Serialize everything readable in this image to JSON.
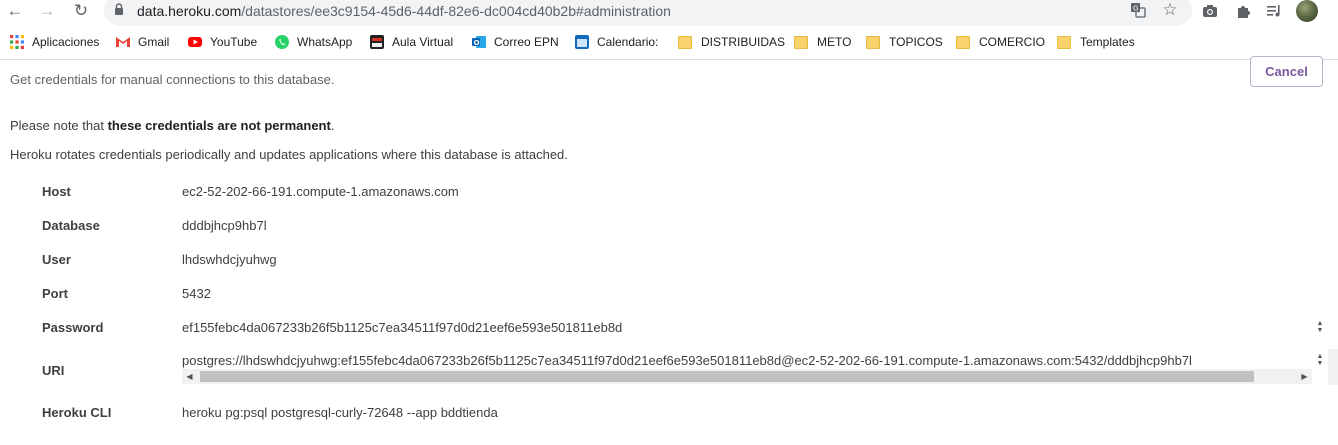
{
  "browser": {
    "url_host": "data.heroku.com",
    "url_path": "/datastores/ee3c9154-45d6-44df-82e6-dc004cd40b2b#administration"
  },
  "bookmarks": [
    {
      "label": "Aplicaciones",
      "icon": "apps-grid-icon"
    },
    {
      "label": "Gmail",
      "icon": "gmail-icon"
    },
    {
      "label": "YouTube",
      "icon": "youtube-icon"
    },
    {
      "label": "WhatsApp",
      "icon": "whatsapp-icon"
    },
    {
      "label": "Aula Virtual",
      "icon": "aula-virtual-icon"
    },
    {
      "label": "Correo EPN",
      "icon": "outlook-icon"
    },
    {
      "label": "Calendario:",
      "icon": "calendar-icon"
    },
    {
      "label": "DISTRIBUIDAS",
      "icon": "folder-icon"
    },
    {
      "label": "METO",
      "icon": "folder-icon"
    },
    {
      "label": "TOPICOS",
      "icon": "folder-icon"
    },
    {
      "label": "COMERCIO",
      "icon": "folder-icon"
    },
    {
      "label": "Templates",
      "icon": "folder-icon"
    }
  ],
  "page": {
    "subtitle": "Get credentials for manual connections to this database.",
    "cancel_label": "Cancel",
    "note_prefix": "Please note that ",
    "note_bold": "these credentials are not permanent",
    "note_suffix": ".",
    "rotation_note": "Heroku rotates credentials periodically and updates applications where this database is attached."
  },
  "credentials": {
    "host": {
      "label": "Host",
      "value": "ec2-52-202-66-191.compute-1.amazonaws.com"
    },
    "database": {
      "label": "Database",
      "value": "dddbjhcp9hb7l"
    },
    "user": {
      "label": "User",
      "value": "lhdswhdcjyuhwg"
    },
    "port": {
      "label": "Port",
      "value": "5432"
    },
    "password": {
      "label": "Password",
      "value": "ef155febc4da067233b26f5b1125c7ea34511f97d0d21eef6e593e501811eb8d"
    },
    "uri": {
      "label": "URI",
      "value": "postgres://lhdswhdcjyuhwg:ef155febc4da067233b26f5b1125c7ea34511f97d0d21eef6e593e501811eb8d@ec2-52-202-66-191.compute-1.amazonaws.com:5432/dddbjhcp9hb7l"
    },
    "cli": {
      "label": "Heroku CLI",
      "value": "heroku pg:psql postgresql-curly-72648 --app bddtienda"
    }
  },
  "colors": {
    "accent_purple": "#79589f",
    "folder_yellow": "#f8d36b"
  }
}
